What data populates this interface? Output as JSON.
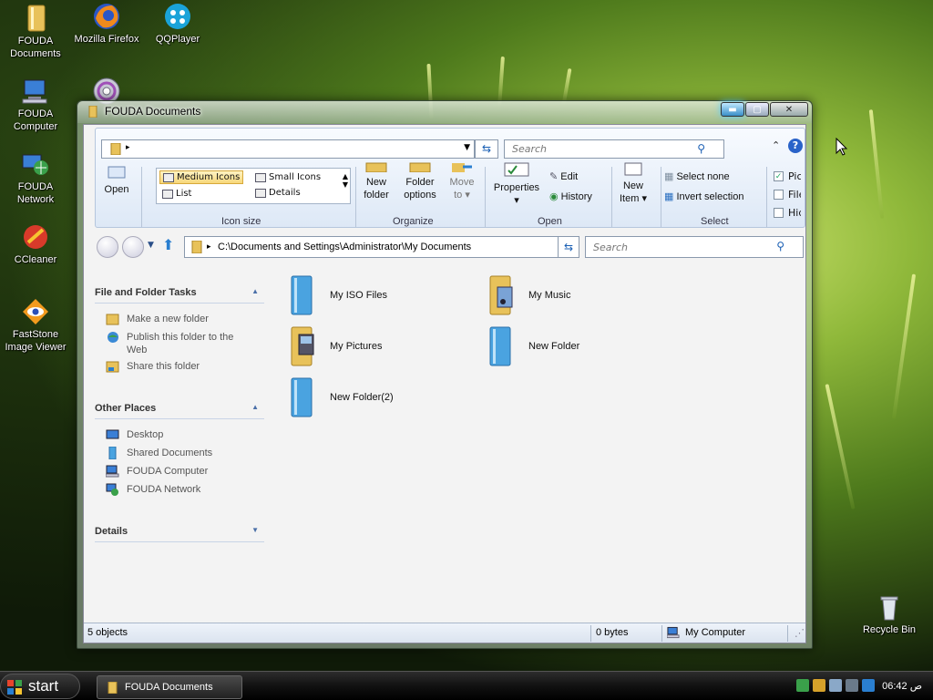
{
  "desktop": {
    "icons": [
      {
        "label": "FOUDA\nDocuments",
        "line1": "FOUDA",
        "line2": "Documents"
      },
      {
        "label": "Mozilla Firefox"
      },
      {
        "label": "QQPlayer"
      },
      {
        "label": "FOUDA\nComputer",
        "line1": "FOUDA",
        "line2": "Computer"
      },
      {
        "label": "FOUDA\nNetwork",
        "line1": "FOUDA",
        "line2": "Network"
      },
      {
        "label": "CCleaner"
      },
      {
        "label": "FastStone\nImage Viewer",
        "line1": "FastStone",
        "line2": "Image Viewer"
      },
      {
        "label": "Recycle Bin"
      }
    ]
  },
  "window": {
    "title": "FOUDA Documents",
    "ribbon": {
      "search_placeholder": "Search",
      "open_label": "Open",
      "views": {
        "medium": "Medium Icons",
        "small": "Small Icons",
        "list": "List",
        "details": "Details"
      },
      "organize": {
        "new_folder": [
          "New",
          "folder"
        ],
        "folder_options": [
          "Folder",
          "options"
        ],
        "move_to": [
          "Move",
          "to"
        ]
      },
      "open_group": {
        "properties": "Properties",
        "edit": "Edit",
        "history": "History"
      },
      "new_item": [
        "New",
        "Item"
      ],
      "select": {
        "select_none": "Select none",
        "invert": "Invert selection"
      },
      "checks": [
        "Pictu",
        "File",
        "Hide"
      ],
      "group_labels": {
        "icon_size": "Icon size",
        "organize": "Organize",
        "open": "Open",
        "select": "Select"
      }
    },
    "address": "C:\\Documents and Settings\\Administrator\\My Documents",
    "search_placeholder": "Search",
    "left_pane": {
      "file_tasks": {
        "title": "File and Folder Tasks",
        "items": [
          "Make a new folder",
          "Publish this folder to the Web",
          "Share this folder"
        ]
      },
      "other_places": {
        "title": "Other Places",
        "items": [
          "Desktop",
          "Shared Documents",
          "FOUDA Computer",
          "FOUDA Network"
        ]
      },
      "details": {
        "title": "Details"
      }
    },
    "items": [
      {
        "name": "My ISO Files"
      },
      {
        "name": "My Music"
      },
      {
        "name": "My Pictures"
      },
      {
        "name": "New Folder"
      },
      {
        "name": "New Folder(2)"
      }
    ],
    "status": {
      "count": "5 objects",
      "size": "0 bytes",
      "location": "My Computer"
    }
  },
  "taskbar": {
    "start": "start",
    "task": "FOUDA Documents",
    "clock": "06:42 ص"
  },
  "colors": {
    "accent": "#1a5fb4",
    "folder_blue": "#4aa3e0",
    "folder_gold": "#e8c25a"
  }
}
